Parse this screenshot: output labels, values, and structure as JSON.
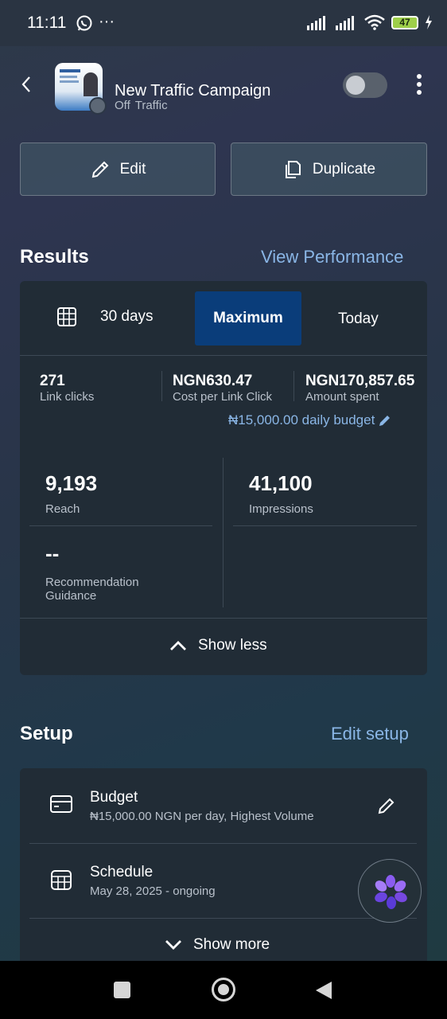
{
  "status_bar": {
    "time": "11:11",
    "more": "···",
    "battery": "47"
  },
  "header": {
    "campaign_name": "New Traffic Campaign",
    "status": "Off",
    "objective": "Traffic"
  },
  "actions": {
    "edit_label": "Edit",
    "duplicate_label": "Duplicate"
  },
  "results": {
    "title": "Results",
    "view_performance": "View Performance",
    "tabs": {
      "days": "30 days",
      "maximum": "Maximum",
      "today": "Today"
    },
    "metrics": [
      {
        "value": "271",
        "label": "Link clicks"
      },
      {
        "value": "NGN630.47",
        "label": "Cost per Link Click"
      },
      {
        "value": "NGN170,857.65",
        "label": "Amount spent"
      }
    ],
    "daily_budget": "₦15,000.00 daily budget",
    "reach": {
      "value": "9,193",
      "label": "Reach"
    },
    "impressions": {
      "value": "41,100",
      "label": "Impressions"
    },
    "recommendation": {
      "value": "--",
      "label_line1": "Recommendation",
      "label_line2": "Guidance"
    },
    "show_less": "Show less"
  },
  "setup": {
    "title": "Setup",
    "edit_setup": "Edit setup",
    "budget": {
      "title": "Budget",
      "detail": "₦15,000.00 NGN per day, Highest Volume"
    },
    "schedule": {
      "title": "Schedule",
      "detail": "May 28, 2025 - ongoing"
    },
    "show_more": "Show more"
  },
  "colors": {
    "accent_link": "#8ab6e6",
    "selected_tab": "#0a3d7a",
    "card_bg": "#212c36"
  }
}
